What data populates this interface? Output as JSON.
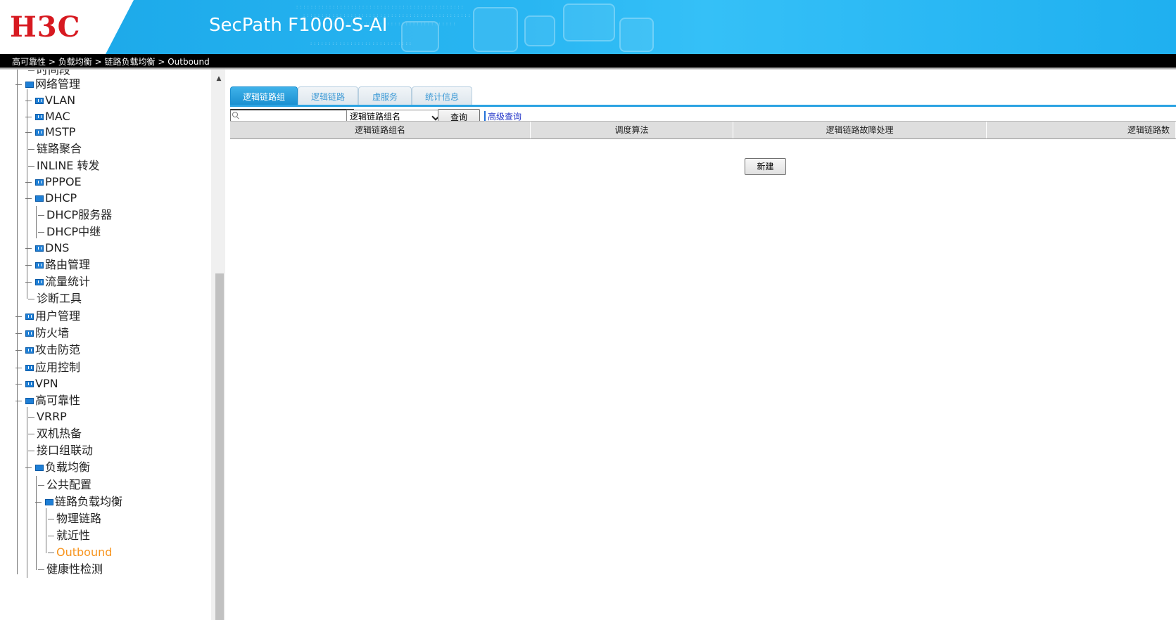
{
  "header": {
    "logo_text": "H3C",
    "product_title": "SecPath F1000-S-AI"
  },
  "breadcrumb": {
    "items": [
      "高可靠性",
      "负载均衡",
      "链路负载均衡",
      "Outbound"
    ],
    "separator": ">"
  },
  "sidebar": {
    "items": [
      {
        "label": "时间段",
        "icon": "none"
      },
      {
        "label": "网络管理",
        "icon": "folder-open-icon"
      },
      {
        "label": "VLAN",
        "icon": "folder-closed-icon"
      },
      {
        "label": "MAC",
        "icon": "folder-closed-icon"
      },
      {
        "label": "MSTP",
        "icon": "folder-closed-icon"
      },
      {
        "label": "链路聚合",
        "icon": "none"
      },
      {
        "label": "INLINE 转发",
        "icon": "none"
      },
      {
        "label": "PPPOE",
        "icon": "folder-closed-icon"
      },
      {
        "label": "DHCP",
        "icon": "folder-open-icon"
      },
      {
        "label": "DHCP服务器",
        "icon": "none"
      },
      {
        "label": "DHCP中继",
        "icon": "none"
      },
      {
        "label": "DNS",
        "icon": "folder-closed-icon"
      },
      {
        "label": "路由管理",
        "icon": "folder-closed-icon"
      },
      {
        "label": "流量统计",
        "icon": "folder-closed-icon"
      },
      {
        "label": "诊断工具",
        "icon": "none"
      },
      {
        "label": "用户管理",
        "icon": "folder-closed-icon"
      },
      {
        "label": "防火墙",
        "icon": "folder-closed-icon"
      },
      {
        "label": "攻击防范",
        "icon": "folder-closed-icon"
      },
      {
        "label": "应用控制",
        "icon": "folder-closed-icon"
      },
      {
        "label": "VPN",
        "icon": "folder-closed-icon"
      },
      {
        "label": "高可靠性",
        "icon": "folder-open-icon"
      },
      {
        "label": "VRRP",
        "icon": "none"
      },
      {
        "label": "双机热备",
        "icon": "none"
      },
      {
        "label": "接口组联动",
        "icon": "none"
      },
      {
        "label": "负载均衡",
        "icon": "folder-open-icon"
      },
      {
        "label": "公共配置",
        "icon": "none"
      },
      {
        "label": "链路负载均衡",
        "icon": "folder-open-icon"
      },
      {
        "label": "物理链路",
        "icon": "none"
      },
      {
        "label": "就近性",
        "icon": "none"
      },
      {
        "label": "Outbound",
        "icon": "none",
        "active": true
      },
      {
        "label": "健康性检测",
        "icon": "none"
      }
    ]
  },
  "tabs": [
    {
      "label": "逻辑链路组",
      "active": true
    },
    {
      "label": "逻辑链路",
      "active": false
    },
    {
      "label": "虚服务",
      "active": false
    },
    {
      "label": "统计信息",
      "active": false
    }
  ],
  "search": {
    "value": "",
    "selected_field": "逻辑链路组名",
    "query_label": "查询",
    "advanced_label": "高级查询"
  },
  "table": {
    "columns": [
      "逻辑链路组名",
      "调度算法",
      "逻辑链路故障处理",
      "逻辑链路数"
    ]
  },
  "actions": {
    "new_label": "新建"
  },
  "colors": {
    "header_blue": "#29b6f2",
    "logo_red": "#d71920",
    "active_link": "#f7941d",
    "tab_active": "#1a8fd0"
  }
}
